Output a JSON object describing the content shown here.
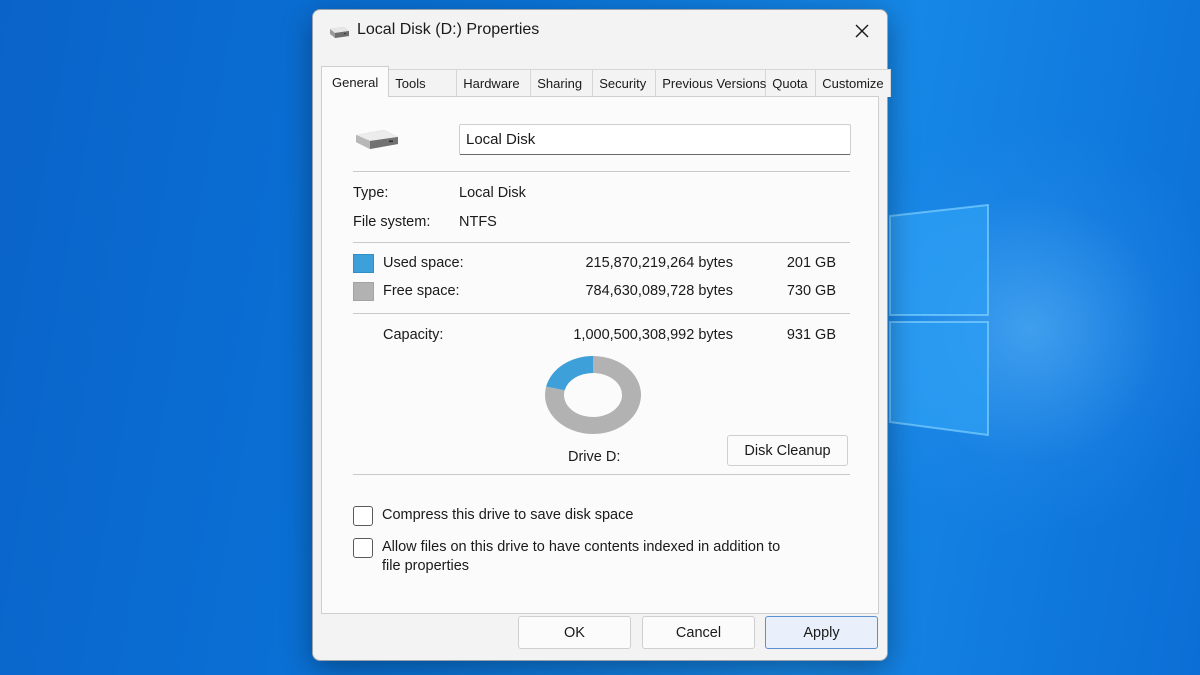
{
  "window": {
    "title": "Local Disk (D:) Properties",
    "close_icon": "close-icon",
    "drive_icon": "drive-icon"
  },
  "tabs": [
    {
      "label": "General",
      "active": true
    },
    {
      "label": "Tools"
    },
    {
      "label": "Hardware"
    },
    {
      "label": "Sharing"
    },
    {
      "label": "Security"
    },
    {
      "label": "Previous Versions"
    },
    {
      "label": "Quota"
    },
    {
      "label": "Customize"
    }
  ],
  "general": {
    "drive_name": "Local Disk",
    "type_label": "Type:",
    "type_value": "Local Disk",
    "fs_label": "File system:",
    "fs_value": "NTFS",
    "used_label": "Used space:",
    "used_bytes": "215,870,219,264 bytes",
    "used_gb": "201 GB",
    "free_label": "Free space:",
    "free_bytes": "784,630,089,728 bytes",
    "free_gb": "730 GB",
    "capacity_label": "Capacity:",
    "capacity_bytes": "1,000,500,308,992 bytes",
    "capacity_gb": "931 GB",
    "drive_label": "Drive D:",
    "cleanup_label": "Disk Cleanup",
    "compress_label": "Compress this drive to save disk space",
    "compress_checked": false,
    "index_label_line1": "Allow files on this drive to have contents indexed in addition to",
    "index_label_line2": "file properties",
    "index_checked": false
  },
  "usage": {
    "used_fraction": 0.2158,
    "used_color": "#3ea0d8",
    "free_color": "#b2b2b2"
  },
  "buttons": {
    "ok": "OK",
    "cancel": "Cancel",
    "apply": "Apply"
  }
}
